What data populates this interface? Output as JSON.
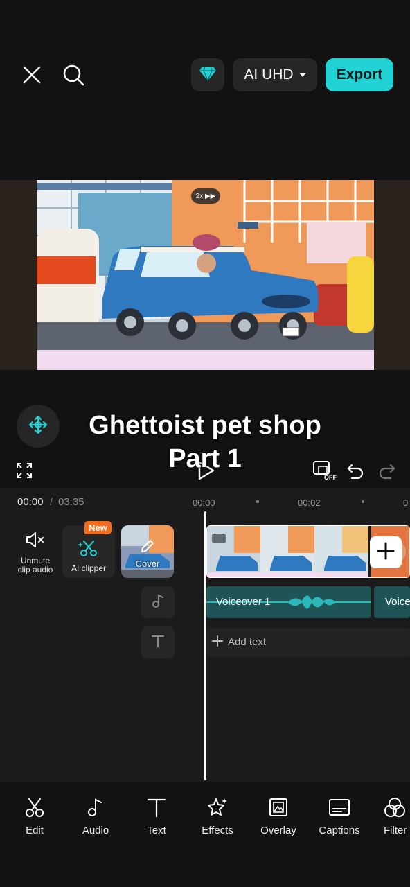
{
  "header": {
    "close_icon": "close-icon",
    "search_icon": "search-icon",
    "gem_icon": "diamond-icon",
    "quality_label": "AI UHD",
    "export_label": "Export",
    "accent_color": "#22d3d6"
  },
  "preview": {
    "speed_badge": "2x ▶▶"
  },
  "caption": {
    "line1": "Ghettoist pet shop",
    "line2": "Part 1"
  },
  "controls": {
    "current_time": "00:00",
    "separator": "/",
    "total_time": "03:35",
    "ticks": [
      "00:00",
      "00:02",
      "0"
    ],
    "toggle_off_label": "OFF"
  },
  "timeline": {
    "unmute_label": "Unmute\nclip audio",
    "ai_clipper_label": "AI clipper",
    "new_badge": "New",
    "cover_label": "Cover",
    "voiceover_label": "Voiceover 1",
    "voiceover2_label": "Voice",
    "add_text_label": "Add text"
  },
  "toolbar": {
    "items": [
      {
        "label": "Edit",
        "icon": "scissors-icon"
      },
      {
        "label": "Audio",
        "icon": "music-note-icon"
      },
      {
        "label": "Text",
        "icon": "text-icon"
      },
      {
        "label": "Effects",
        "icon": "sparkle-star-icon"
      },
      {
        "label": "Overlay",
        "icon": "overlay-icon"
      },
      {
        "label": "Captions",
        "icon": "captions-icon"
      },
      {
        "label": "Filter",
        "icon": "filter-icon"
      }
    ]
  }
}
